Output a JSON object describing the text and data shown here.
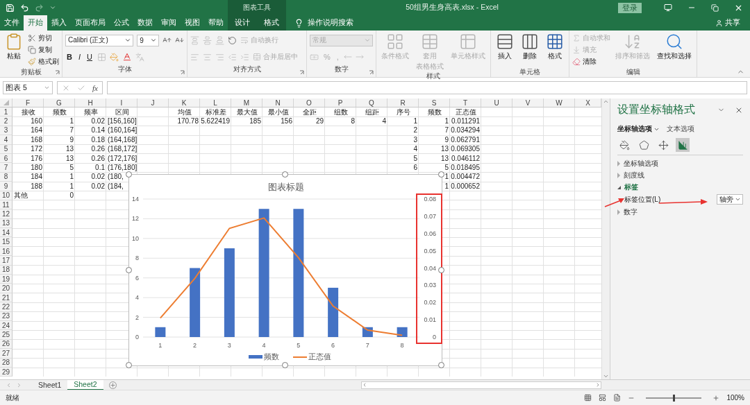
{
  "title_bar": {
    "context_group": "图表工具",
    "document_title": "50组男生身高表.xlsx  -  Excel",
    "sign_in": "登录"
  },
  "menu_tabs": [
    {
      "label": "文件",
      "selected": false,
      "contextual": false
    },
    {
      "label": "开始",
      "selected": true,
      "contextual": false
    },
    {
      "label": "插入",
      "selected": false,
      "contextual": false
    },
    {
      "label": "页面布局",
      "selected": false,
      "contextual": false
    },
    {
      "label": "公式",
      "selected": false,
      "contextual": false
    },
    {
      "label": "数据",
      "selected": false,
      "contextual": false
    },
    {
      "label": "审阅",
      "selected": false,
      "contextual": false
    },
    {
      "label": "视图",
      "selected": false,
      "contextual": false
    },
    {
      "label": "帮助",
      "selected": false,
      "contextual": false
    },
    {
      "label": "设计",
      "selected": false,
      "contextual": true
    },
    {
      "label": "格式",
      "selected": false,
      "contextual": true
    }
  ],
  "tell_me": "操作说明搜索",
  "share": "共享",
  "ribbon": [
    {
      "kind": "buttons",
      "title": "剪贴板",
      "launcher": true,
      "items": [
        {
          "kind": "large",
          "label": "粘贴",
          "disabled": false
        },
        {
          "kind": "small",
          "label": "剪切",
          "disabled": false
        },
        {
          "kind": "small",
          "label": "复制",
          "disabled": false
        },
        {
          "kind": "small",
          "label": "格式刷",
          "disabled": false
        }
      ]
    },
    {
      "kind": "font",
      "title": "字体",
      "launcher": true,
      "font_name": "Calibri (正文)",
      "font_size": "9",
      "buttons": [
        "B",
        "I",
        "U"
      ]
    },
    {
      "kind": "alignment",
      "title": "对齐方式",
      "launcher": true,
      "items": [
        {
          "label": "自动换行",
          "disabled": true
        },
        {
          "label": "合并后居中",
          "disabled": true
        }
      ]
    },
    {
      "kind": "number",
      "title": "数字",
      "launcher": true,
      "format": "常规",
      "format_disabled": true,
      "buttons": [
        "%",
        ","
      ]
    },
    {
      "kind": "buttons",
      "title": "样式",
      "launcher": false,
      "items": [
        {
          "kind": "large",
          "label": "条件格式",
          "disabled": true
        },
        {
          "kind": "large",
          "label": "套用",
          "label2": "表格格式",
          "disabled": true
        },
        {
          "kind": "large",
          "label": "单元格样式",
          "disabled": true
        }
      ]
    },
    {
      "kind": "buttons",
      "title": "单元格",
      "launcher": false,
      "items": [
        {
          "kind": "large",
          "label": "插入",
          "disabled": false
        },
        {
          "kind": "large",
          "label": "删除",
          "disabled": false
        },
        {
          "kind": "large",
          "label": "格式",
          "disabled": false
        }
      ]
    },
    {
      "kind": "buttons",
      "title": "编辑",
      "launcher": false,
      "items": [
        {
          "kind": "small",
          "label": "自动求和",
          "disabled": true
        },
        {
          "kind": "small",
          "label": "填充",
          "disabled": true
        },
        {
          "kind": "small",
          "label": "清除",
          "disabled": false
        },
        {
          "kind": "large",
          "label": "排序和筛选",
          "disabled": true
        },
        {
          "kind": "large",
          "label": "查找和选择",
          "disabled": false
        }
      ]
    }
  ],
  "formula_bar": {
    "name_box": "图表 5",
    "fx": "fx"
  },
  "sheet": {
    "columns": [
      "F",
      "G",
      "H",
      "I",
      "J",
      "K",
      "L",
      "M",
      "N",
      "O",
      "P",
      "Q",
      "R",
      "S",
      "T",
      "U",
      "V",
      "W",
      "X"
    ],
    "rows": [
      {
        "number": "1",
        "kind": "header",
        "cells": {
          "F": "接收",
          "G": "频数",
          "H": "频率",
          "I": "区间",
          "K": "均值",
          "L": "标准差",
          "M": "最大值",
          "N": "最小值",
          "O": "全距",
          "P": "组数",
          "Q": "组距",
          "R": "序号",
          "S": "频数",
          "T": "正态值"
        }
      },
      {
        "number": "2",
        "kind": "data",
        "cells": {
          "F": "160",
          "G": "1",
          "H": "0.02",
          "I": "[156,160]",
          "K": "170.78",
          "L": "5.622419",
          "M": "185",
          "N": "156",
          "O": "29",
          "P": "8",
          "Q": "4",
          "R": "1",
          "S": "1",
          "T": "0.011291"
        }
      },
      {
        "number": "3",
        "kind": "data",
        "cells": {
          "F": "164",
          "G": "7",
          "H": "0.14",
          "I": "(160,164]",
          "R": "2",
          "S": "7",
          "T": "0.034294"
        }
      },
      {
        "number": "4",
        "kind": "data",
        "cells": {
          "F": "168",
          "G": "9",
          "H": "0.18",
          "I": "(164,168]",
          "R": "3",
          "S": "9",
          "T": "0.062791"
        }
      },
      {
        "number": "5",
        "kind": "data",
        "cells": {
          "F": "172",
          "G": "13",
          "H": "0.26",
          "I": "(168,172]",
          "R": "4",
          "S": "13",
          "T": "0.069305"
        }
      },
      {
        "number": "6",
        "kind": "data",
        "cells": {
          "F": "176",
          "G": "13",
          "H": "0.26",
          "I": "(172,176]",
          "R": "5",
          "S": "13",
          "T": "0.046112"
        }
      },
      {
        "number": "7",
        "kind": "data",
        "cells": {
          "F": "180",
          "G": "5",
          "H": "0.1",
          "I": "(176,180]",
          "R": "6",
          "S": "5",
          "T": "0.018495"
        }
      },
      {
        "number": "8",
        "kind": "data",
        "cells": {
          "F": "184",
          "G": "1",
          "H": "0.02",
          "I": "(180,",
          "S": "1",
          "T": "0.004472"
        }
      },
      {
        "number": "9",
        "kind": "data",
        "cells": {
          "F": "188",
          "G": "1",
          "H": "0.02",
          "I": "(184,",
          "S": "1",
          "T": "0.000652"
        }
      },
      {
        "number": "10",
        "kind": "data",
        "cells": {
          "F": "其他",
          "G": "0"
        }
      },
      {
        "number": "11",
        "kind": "data"
      },
      {
        "number": "12",
        "kind": "data"
      },
      {
        "number": "13",
        "kind": "data"
      },
      {
        "number": "14",
        "kind": "data"
      },
      {
        "number": "15",
        "kind": "data"
      },
      {
        "number": "16",
        "kind": "data"
      },
      {
        "number": "17",
        "kind": "data"
      },
      {
        "number": "18",
        "kind": "data"
      },
      {
        "number": "19",
        "kind": "data"
      },
      {
        "number": "20",
        "kind": "data"
      },
      {
        "number": "21",
        "kind": "data"
      },
      {
        "number": "22",
        "kind": "data"
      },
      {
        "number": "23",
        "kind": "data"
      },
      {
        "number": "24",
        "kind": "data"
      },
      {
        "number": "25",
        "kind": "data"
      },
      {
        "number": "26",
        "kind": "data"
      },
      {
        "number": "27",
        "kind": "data"
      },
      {
        "number": "28",
        "kind": "data"
      },
      {
        "number": "29",
        "kind": "data"
      }
    ]
  },
  "chart": {
    "selected": true,
    "axis_highlight": true,
    "chart_data": {
      "type": "bar",
      "title": "图表标题",
      "grid": true,
      "categories": [
        "1",
        "2",
        "3",
        "4",
        "5",
        "6",
        "7",
        "8"
      ],
      "series": [
        {
          "name": "频数",
          "color": "#4472c4",
          "type": "bar",
          "values": [
            1,
            7,
            9,
            13,
            13,
            5,
            1,
            1
          ]
        },
        {
          "name": "正态值",
          "color": "#ed7d31",
          "type": "line",
          "axis": "y2",
          "values": [
            0.011,
            0.034,
            0.063,
            0.069,
            0.046,
            0.018,
            0.004,
            0.001
          ]
        }
      ],
      "ylim": [
        0,
        14
      ],
      "yticks": [
        {
          "value": 0,
          "label": "0"
        },
        {
          "value": 2,
          "label": "2"
        },
        {
          "value": 4,
          "label": "4"
        },
        {
          "value": 6,
          "label": "6"
        },
        {
          "value": 8,
          "label": "8"
        },
        {
          "value": 10,
          "label": "10"
        },
        {
          "value": 12,
          "label": "12"
        },
        {
          "value": 14,
          "label": "14"
        }
      ],
      "y2lim": [
        0,
        0.08
      ],
      "y2ticks": [
        {
          "value": 0,
          "label": "0"
        },
        {
          "value": 0.01,
          "label": "0.01"
        },
        {
          "value": 0.02,
          "label": "0.02"
        },
        {
          "value": 0.03,
          "label": "0.03"
        },
        {
          "value": 0.04,
          "label": "0.04"
        },
        {
          "value": 0.05,
          "label": "0.05"
        },
        {
          "value": 0.06,
          "label": "0.06"
        },
        {
          "value": 0.07,
          "label": "0.07"
        },
        {
          "value": 0.08,
          "label": "0.08"
        }
      ],
      "legend": "bottom"
    }
  },
  "sheet_tabs": [
    {
      "label": "Sheet1",
      "selected": false
    },
    {
      "label": "Sheet2",
      "selected": true
    }
  ],
  "pane": {
    "title": "设置坐标轴格式",
    "tabs": [
      {
        "label": "坐标轴选项",
        "selected": true
      },
      {
        "label": "文本选项",
        "selected": false
      }
    ],
    "icon_tabs": [
      {
        "selected": false
      },
      {
        "selected": false
      },
      {
        "selected": false
      },
      {
        "selected": true
      }
    ],
    "sections": [
      {
        "label": "坐标轴选项",
        "expanded": false
      },
      {
        "label": "刻度线",
        "expanded": false
      },
      {
        "label": "标签",
        "expanded": true,
        "field": {
          "label": "标签位置(L)",
          "value": "轴旁"
        }
      },
      {
        "label": "数字",
        "expanded": false
      }
    ],
    "annotation_arrows": true
  },
  "status_bar": {
    "status": "就绪",
    "zoom": "100%",
    "zoom_slider": {
      "level": 0.5
    }
  }
}
